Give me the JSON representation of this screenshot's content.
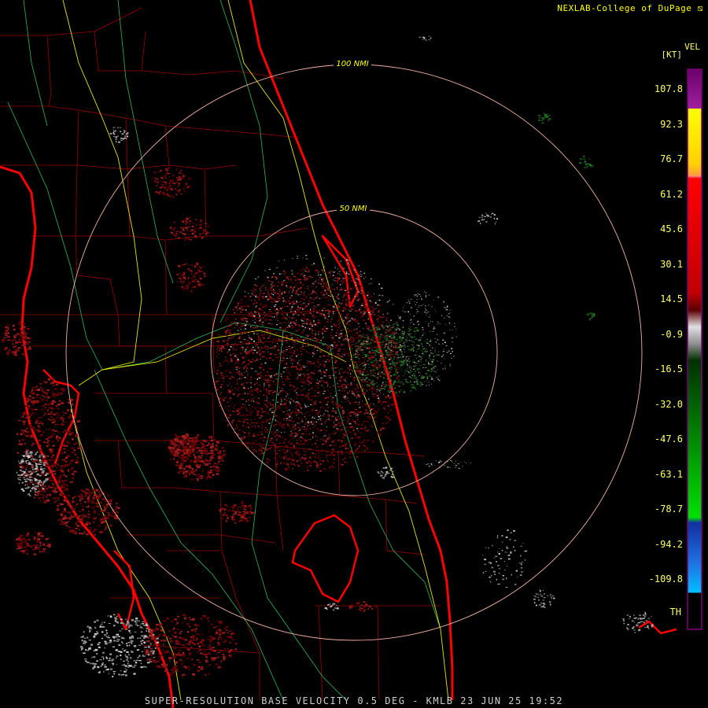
{
  "header": {
    "brand": "NEXLAB-College of DuPage"
  },
  "legend": {
    "product": "VEL",
    "unit": "[KT]",
    "ticks": [
      "107.8",
      "92.3",
      "76.7",
      "61.2",
      "45.6",
      "30.1",
      "14.5",
      "-0.9",
      "-16.5",
      "-32.0",
      "-47.6",
      "-63.1",
      "-78.7",
      "-94.2",
      "-109.8"
    ],
    "th_label": "TH",
    "colors": {
      "purple": "#8b0d8b",
      "yellow": "#ffff00",
      "orange": "#f5a060",
      "red": "#ff0000",
      "darkred": "#5a0000",
      "gray": "#c0c0c0",
      "green": "#00c800",
      "blue": "#1e50d0",
      "cyan": "#00aaff"
    }
  },
  "map": {
    "radar_site": "KMLB",
    "range_rings": [
      {
        "label": "50 NMI"
      },
      {
        "label": "100 NMI"
      }
    ]
  },
  "footer": {
    "caption": "SUPER-RESOLUTION BASE VELOCITY 0.5 DEG - KMLB 23 JUN 25 19:52"
  }
}
